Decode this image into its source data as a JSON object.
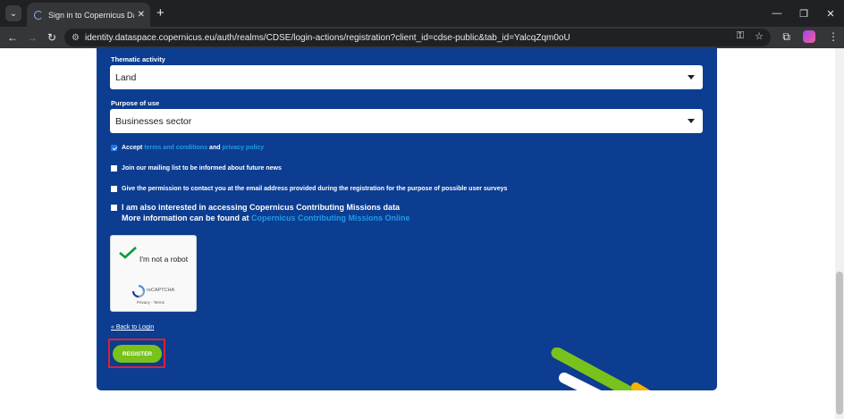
{
  "browser": {
    "tab_title": "Sign in to Copernicus Data Spac",
    "url": "identity.dataspace.copernicus.eu/auth/realms/CDSE/login-actions/registration?client_id=cdse-public&tab_id=YalcqZqm0oU"
  },
  "form": {
    "thematic_activity": {
      "label": "Thematic activity",
      "value": "Land"
    },
    "purpose_of_use": {
      "label": "Purpose of use",
      "value": "Businesses sector"
    },
    "accept": {
      "checked": true,
      "prefix": "Accept",
      "terms_link": "terms and conditions",
      "and": "and",
      "privacy_link": "privacy policy"
    },
    "mailing_list": {
      "checked": false,
      "label": "Join our mailing list to be informed about future news"
    },
    "permission": {
      "checked": false,
      "label": "Give the permission to contact you at the email address provided during the registration for the purpose of possible user surveys"
    },
    "contributing": {
      "checked": false,
      "line1": "I am also interested in accessing Copernicus Contributing Missions data",
      "line2_prefix": "More information can be found at",
      "line2_link": "Copernicus Contributing Missions Online"
    },
    "recaptcha": {
      "label": "I'm not a robot",
      "brand": "reCAPTCHA",
      "terms": "Privacy - Terms"
    },
    "back_link": "« Back to Login",
    "register_label": "REGISTER"
  },
  "colors": {
    "panel": "#0c3d91",
    "accent_green": "#79c21b",
    "link": "#1f9be9",
    "highlight": "#e02030"
  }
}
